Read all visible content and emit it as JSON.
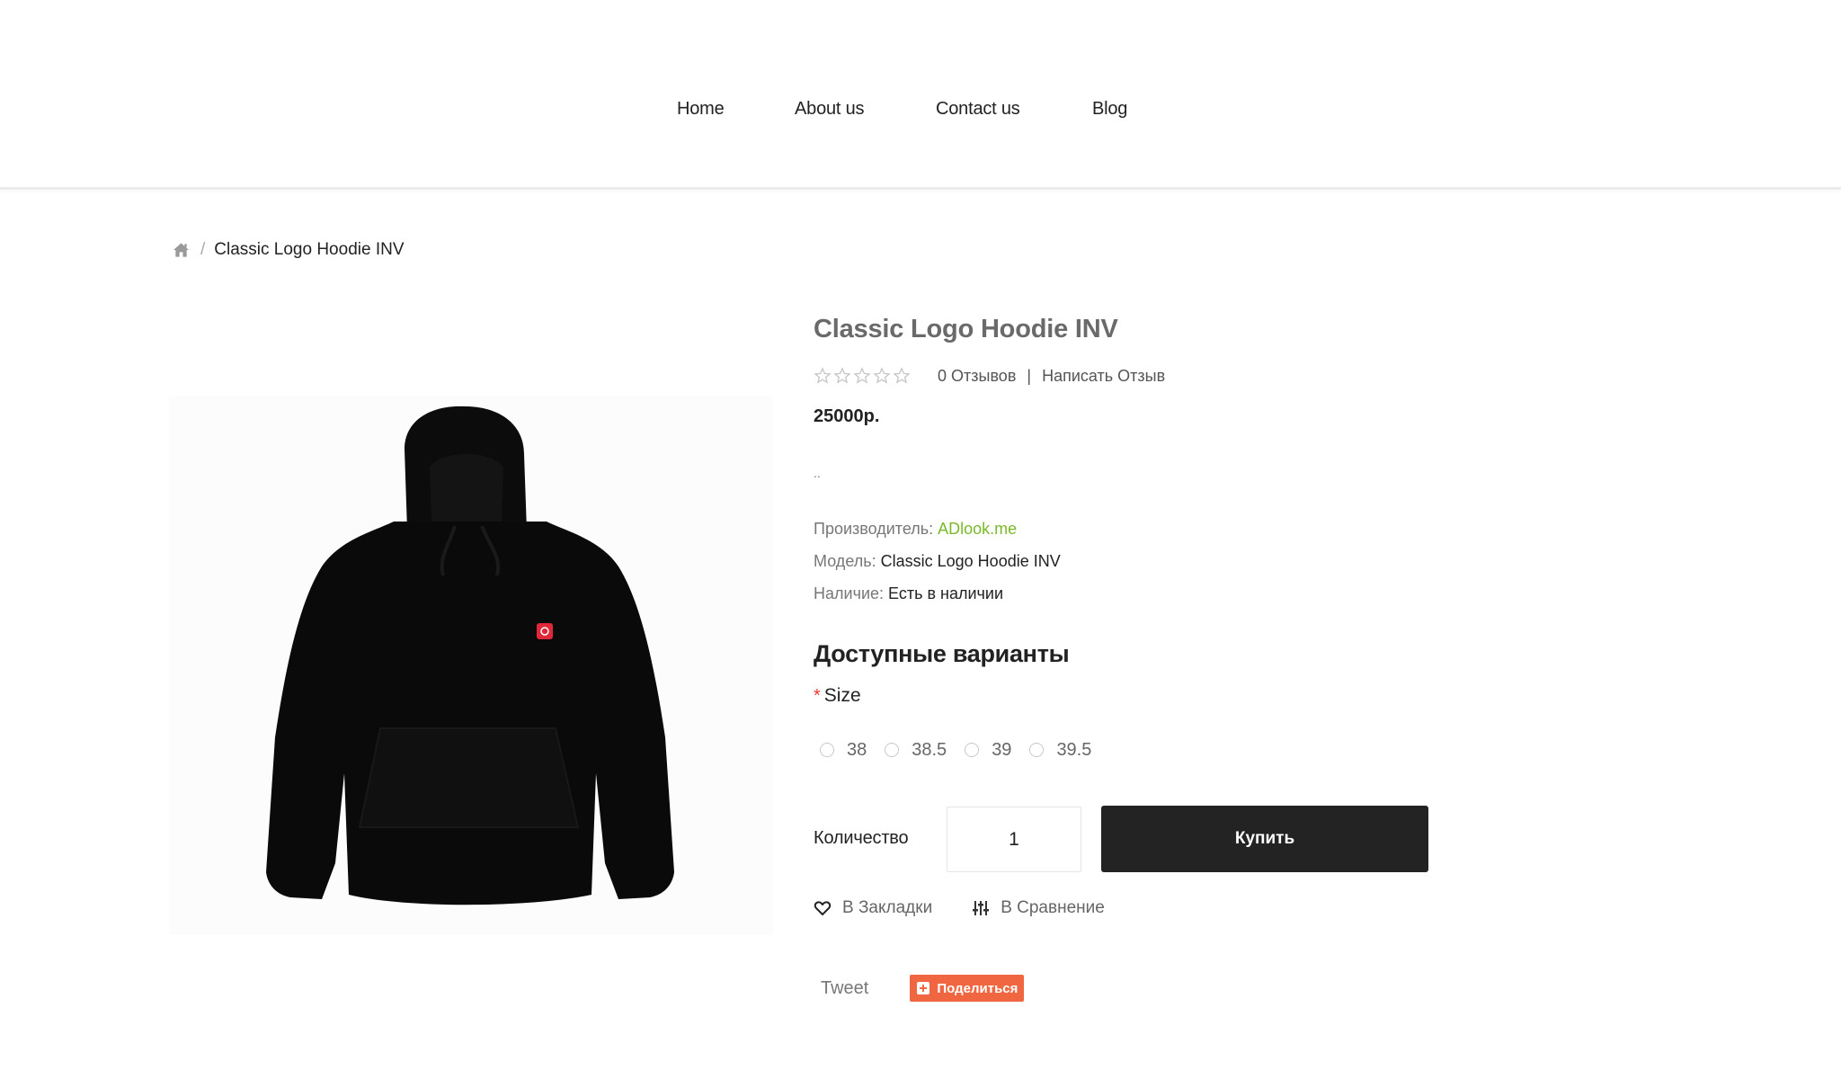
{
  "nav": {
    "items": [
      {
        "label": "Home"
      },
      {
        "label": "About us"
      },
      {
        "label": "Contact us"
      },
      {
        "label": "Blog"
      }
    ]
  },
  "breadcrumb": {
    "home_icon": "home-icon",
    "separator": "/",
    "current": "Classic Logo Hoodie INV"
  },
  "product": {
    "image_alt": "Black hoodie with red logo patch",
    "title": "Classic Logo Hoodie INV",
    "rating": {
      "value": 0,
      "max": 5,
      "reviews_label": "0 Отзывов",
      "separator": "|",
      "write_review_label": "Написать Отзыв"
    },
    "price": "25000р.",
    "description": "..",
    "specs": {
      "manufacturer_label": "Производитель:",
      "manufacturer_value": "ADlook.me",
      "model_label": "Модель:",
      "model_value": "Classic Logo Hoodie INV",
      "availability_label": "Наличие:",
      "availability_value": "Есть в наличии"
    },
    "options": {
      "title": "Доступные варианты",
      "size_required_marker": "*",
      "size_label": "Size",
      "sizes": [
        {
          "label": "38",
          "selected": false
        },
        {
          "label": "38.5",
          "selected": false
        },
        {
          "label": "39",
          "selected": false
        },
        {
          "label": "39.5",
          "selected": false
        }
      ]
    },
    "quantity": {
      "label": "Количество",
      "value": "1"
    },
    "buy_label": "Купить",
    "actions": {
      "wishlist_label": "В Закладки",
      "wishlist_icon": "heart-icon",
      "compare_label": "В Сравнение",
      "compare_icon": "sliders-icon"
    },
    "share": {
      "tweet_label": "Tweet",
      "share_label": "Поделиться"
    }
  },
  "colors": {
    "accent_link": "#7ab929",
    "buy_button": "#232323",
    "share_button": "#ef6640",
    "required_marker": "#e53935",
    "title_gray": "#6a6a6a"
  }
}
